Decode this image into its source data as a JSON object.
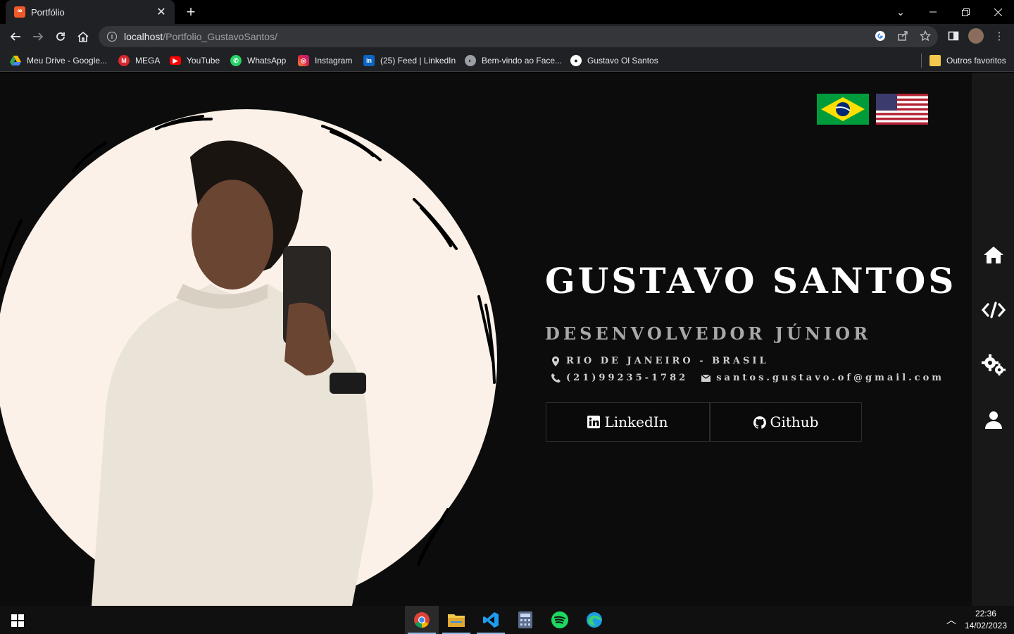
{
  "browser": {
    "tab_title": "Portfólio",
    "tab_close": "✕",
    "new_tab": "+",
    "url_host": "localhost",
    "url_path": "/Portfolio_GustavoSantos/",
    "bookmarks": [
      {
        "label": "Meu Drive - Google...",
        "icon": "google-drive-icon",
        "color": "#34a853"
      },
      {
        "label": "MEGA",
        "icon": "mega-icon",
        "color": "#d9272e"
      },
      {
        "label": "YouTube",
        "icon": "youtube-icon",
        "color": "#ff0000"
      },
      {
        "label": "WhatsApp",
        "icon": "whatsapp-icon",
        "color": "#25d366"
      },
      {
        "label": "Instagram",
        "icon": "instagram-icon",
        "color": "#d6249f"
      },
      {
        "label": "(25) Feed | LinkedIn",
        "icon": "linkedin-icon",
        "color": "#0a66c2"
      },
      {
        "label": "Bem-vindo ao Face...",
        "icon": "globe-icon",
        "color": "#9aa0a6"
      },
      {
        "label": "Gustavo Ol Santos",
        "icon": "github-icon",
        "color": "#ffffff"
      }
    ],
    "other_bookmarks": "Outros favoritos"
  },
  "hero": {
    "name": "GUSTAVO SANTOS",
    "role": "DESENVOLVEDOR JÚNIOR",
    "location": "RIO DE JANEIRO - BRASIL",
    "phone": "(21)99235-1782",
    "email": "santos.gustavo.of@gmail.com",
    "linkedin_label": "LinkedIn",
    "github_label": "Github",
    "photo_bg_color": "#fbf1e8"
  },
  "languages": [
    {
      "flag": "brazil-flag",
      "lang": "pt-BR"
    },
    {
      "flag": "usa-flag",
      "lang": "en"
    }
  ],
  "sidenav": [
    "home-icon",
    "code-icon",
    "gears-icon",
    "user-icon"
  ],
  "taskbar": {
    "apps": [
      "chrome-icon",
      "file-explorer-icon",
      "vscode-icon",
      "calculator-icon",
      "spotify-icon",
      "edge-icon"
    ],
    "time": "22:36",
    "date": "14/02/2023"
  }
}
